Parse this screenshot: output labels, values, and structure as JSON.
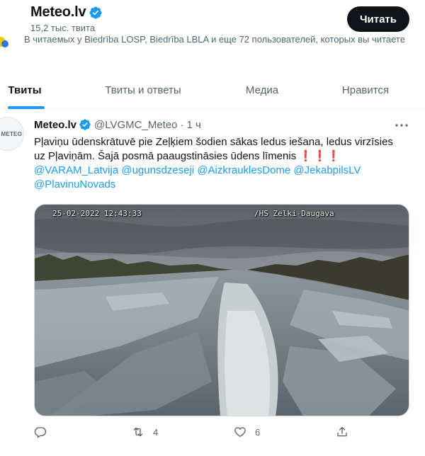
{
  "header": {
    "account_name": "Meteo.lv",
    "tweet_count": "15,2 тыс. твита",
    "follow_button": "Читать"
  },
  "followers": {
    "text": "В читаемых у Biedrība LOSP, Biedrība LBLA и еще 72 пользователей, которых вы читаете"
  },
  "tabs": [
    {
      "label": "Твиты",
      "active": true
    },
    {
      "label": "Твиты и ответы",
      "active": false
    },
    {
      "label": "Медиа",
      "active": false
    },
    {
      "label": "Нравится",
      "active": false
    }
  ],
  "tweet": {
    "avatar_text": "METEO",
    "name": "Meteo.lv",
    "handle": "@LVGMC_Meteo",
    "separator": "·",
    "time": "1 ч",
    "text_line1": "Pļaviņu ūdenskrātuvē pie Zeļķiem šodien sākas ledus iešana, ledus virzīsies",
    "text_line2": "uz Pļaviņām. Šajā posmā paaugstināsies ūdens līmenis",
    "emphasis": "❗❗❗",
    "mentions": [
      "@VARAM_Latvija",
      "@ugunsdzeseji",
      "@AizkrauklesDome",
      "@JekabpilsLV",
      "@PlavinuNovads"
    ],
    "image": {
      "timestamp": "25-02-2022 12:43:33",
      "camera_label": "/HS Zelki-Daugava"
    },
    "actions": {
      "reply_count": "",
      "retweet_count": "4",
      "like_count": "6"
    }
  },
  "colors": {
    "accent": "#1d9bf0",
    "text_primary": "#0f1419",
    "text_secondary": "#536471",
    "button_bg": "#0f1419"
  }
}
